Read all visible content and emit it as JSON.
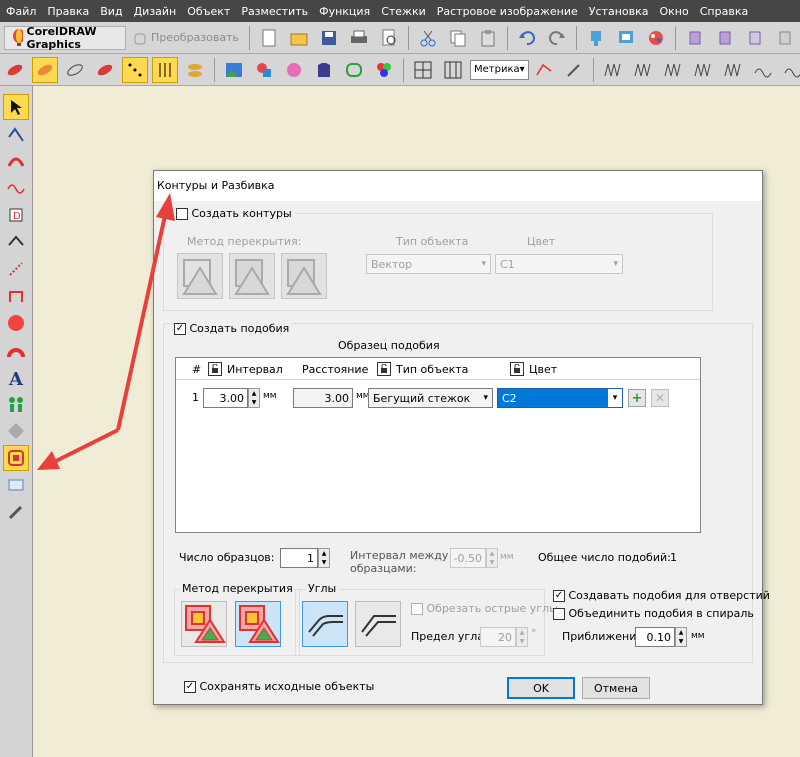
{
  "menubar": {
    "items": [
      "Файл",
      "Правка",
      "Вид",
      "Дизайн",
      "Объект",
      "Разместить",
      "Функция",
      "Стежки",
      "Растровое изображение",
      "Установка",
      "Окно",
      "Справка"
    ]
  },
  "toolbar": {
    "app_label": "CorelDRAW Graphics",
    "convert_label": "Преобразовать",
    "units_value": "Метрика"
  },
  "dialog": {
    "title": "Контуры и Разбивка",
    "outlines": {
      "checkbox_label": "Создать контуры",
      "checked": false,
      "overlap_label": "Метод перекрытия:",
      "object_type_label": "Тип объекта",
      "object_type_value": "Вектор",
      "color_label": "Цвет",
      "color_value": "C1"
    },
    "similar": {
      "checkbox_label": "Создать подобия",
      "checked": true,
      "sample_label": "Образец подобия",
      "columns": [
        "#",
        "Интервал",
        "Расстояние",
        "Тип объекта",
        "Цвет"
      ],
      "rows": [
        {
          "index": "1",
          "interval": "3.00",
          "interval_unit": "мм",
          "distance": "3.00",
          "distance_unit": "мм",
          "object_type": "Бегущий стежок",
          "color": "C2"
        }
      ],
      "samples_count_label": "Число образцов:",
      "samples_count_value": "1",
      "sample_interval_label": "Интервал между образцами:",
      "sample_interval_value": "-0.50",
      "sample_interval_unit": "мм",
      "total_label": "Общее число подобий:",
      "total_value": "1",
      "overlap_method_label": "Метод перекрытия",
      "corners_label": "Углы",
      "cut_sharp_label": "Обрезать острые углы",
      "angle_limit_label": "Предел угла:",
      "angle_limit_value": "20",
      "angle_unit": "°",
      "holes_label": "Создавать подобия для отверстий",
      "holes_checked": true,
      "spiral_label": "Объединить подобия в спираль",
      "spiral_checked": false,
      "approx_label": "Приближение:",
      "approx_value": "0.10",
      "approx_unit": "мм"
    },
    "keep_originals_label": "Сохранять исходные объекты",
    "keep_originals_checked": true,
    "ok_label": "OK",
    "cancel_label": "Отмена"
  },
  "annotation_color": "#e8403a"
}
